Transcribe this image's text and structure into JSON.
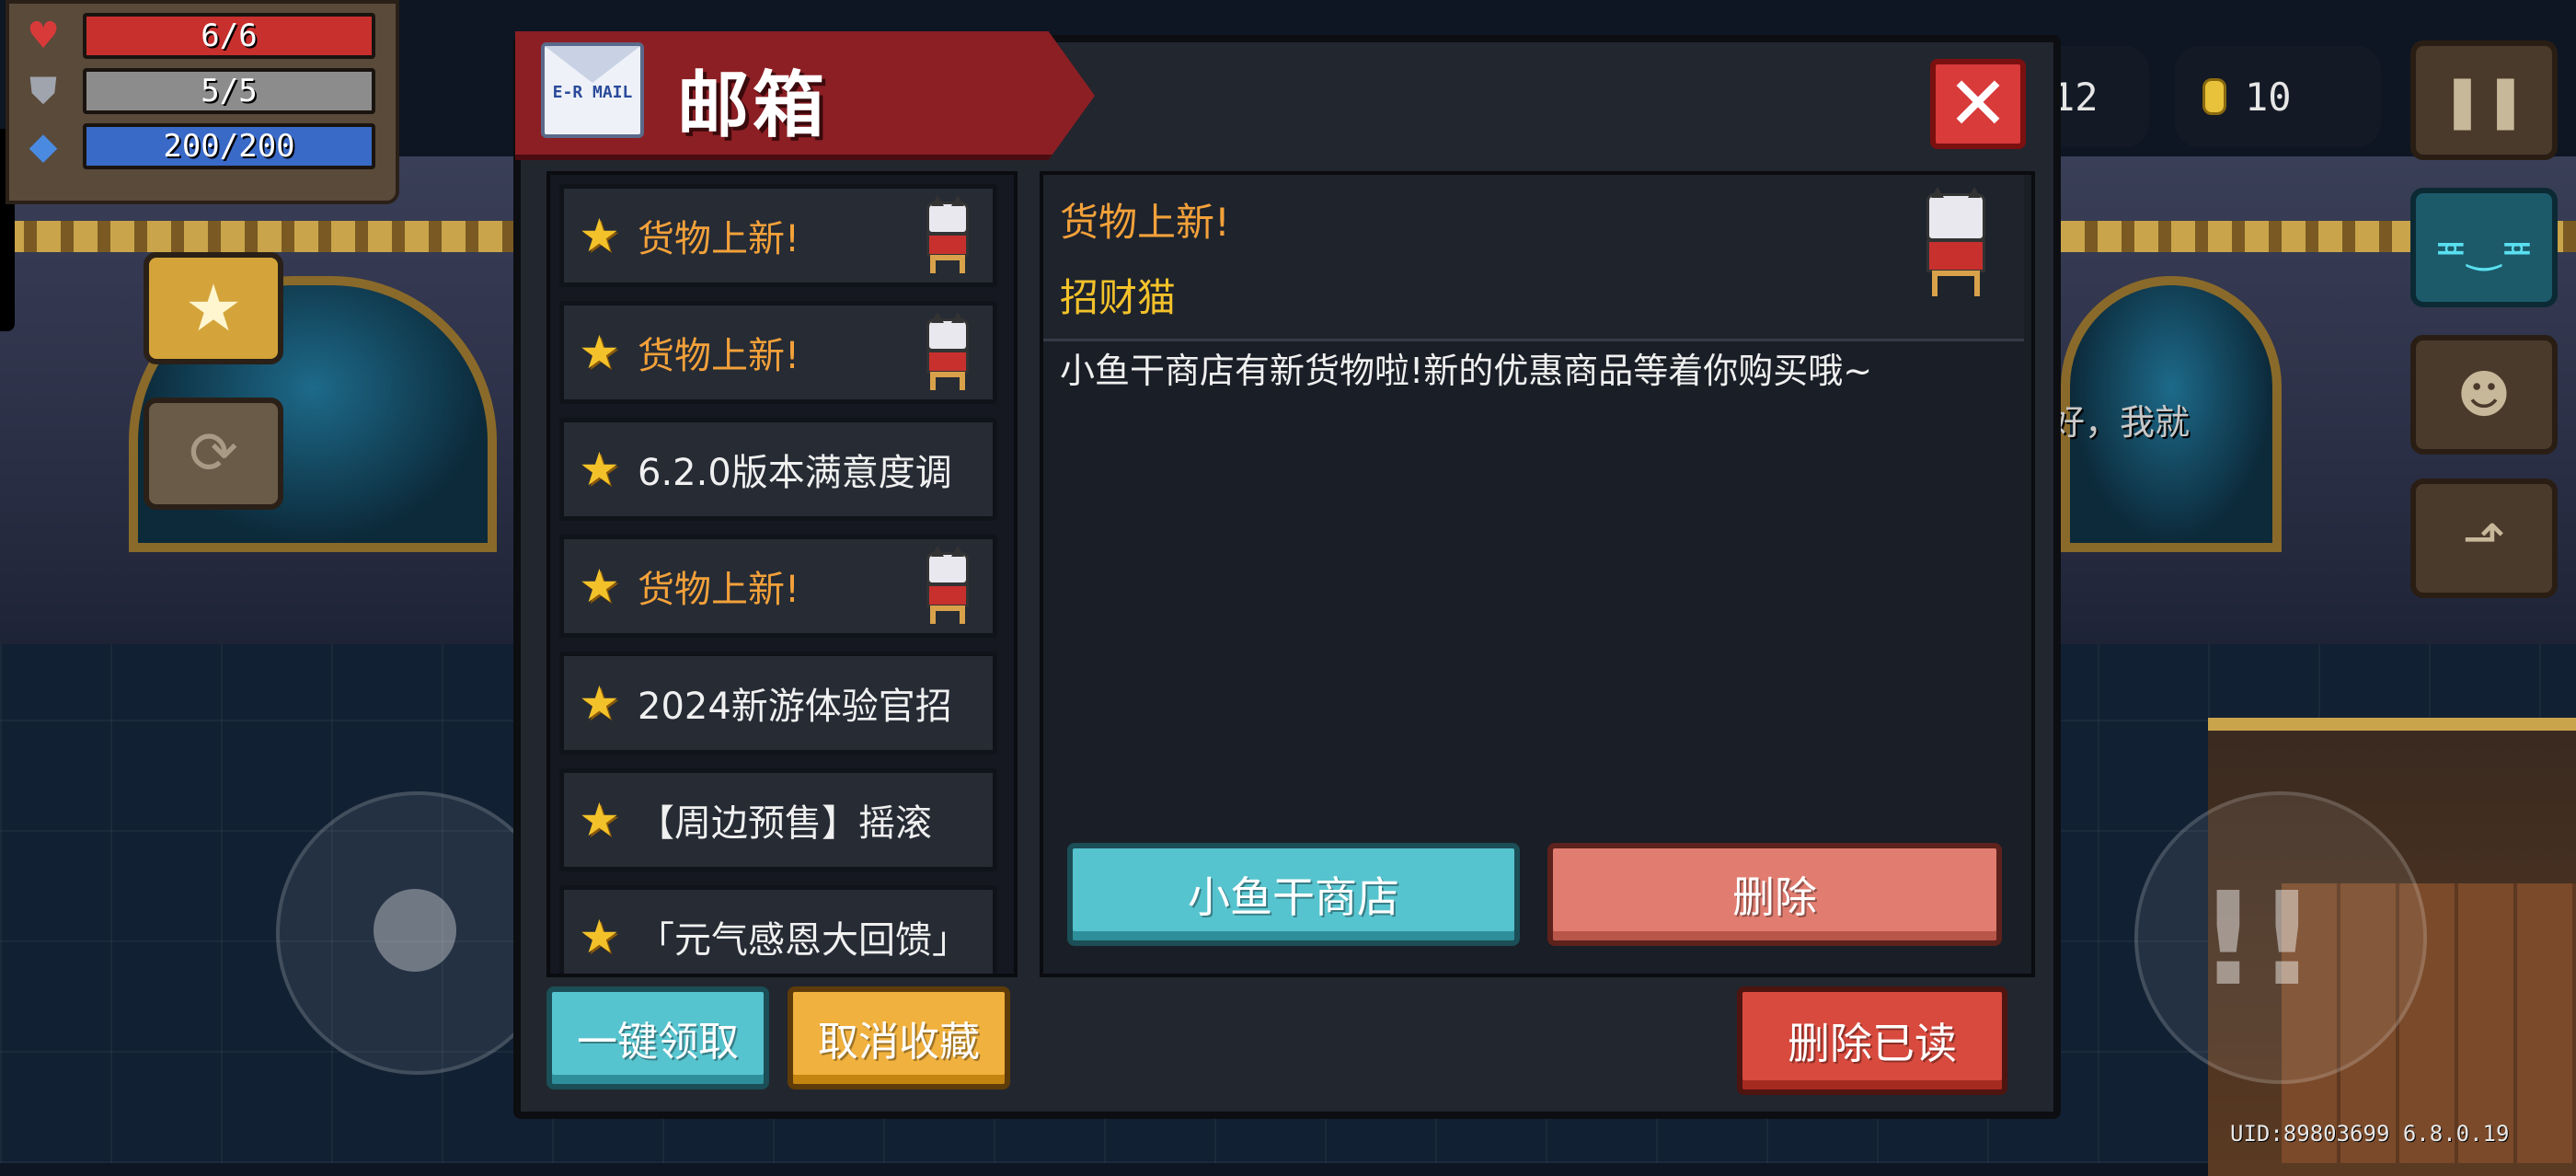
{
  "hud": {
    "hp": "6/6",
    "armor": "5/5",
    "energy": "200/200",
    "hp_fraction": 1.0,
    "armor_fraction": 1.0,
    "energy_fraction": 1.0,
    "gems": "12",
    "coins": "10"
  },
  "mailbox": {
    "title": "邮箱",
    "icon_label": "E-R MAIL",
    "mails": [
      {
        "title": "货物上新!",
        "highlight": true,
        "has_cat": true
      },
      {
        "title": "货物上新!",
        "highlight": true,
        "has_cat": true
      },
      {
        "title": "6.2.0版本满意度调",
        "highlight": false,
        "has_cat": false
      },
      {
        "title": "货物上新!",
        "highlight": true,
        "has_cat": true
      },
      {
        "title": "2024新游体验官招",
        "highlight": false,
        "has_cat": false
      },
      {
        "title": "【周边预售】摇滚",
        "highlight": false,
        "has_cat": false
      },
      {
        "title": "「元气感恩大回馈」",
        "highlight": false,
        "has_cat": false
      }
    ],
    "detail": {
      "title": "货物上新!",
      "sender": "招财猫",
      "body": "小鱼干商店有新货物啦!新的优惠商品等着你购买哦~"
    },
    "buttons": {
      "shop": "小鱼干商店",
      "delete": "删除",
      "claim_all": "一键领取",
      "unfavorite": "取消收藏",
      "delete_read": "删除已读"
    }
  },
  "background_text": "好，我就",
  "uid_version": "UID:89803699 6.8.0.19",
  "colors": {
    "banner_red": "#8c1f24",
    "close_red": "#d93a3a",
    "teal_button": "#56c4cf",
    "salmon_button": "#e17d70",
    "gold_button": "#f0b13e",
    "star_gold": "#f3c22a",
    "highlight_orange": "#f3a13a"
  },
  "icons": [
    "heart-icon",
    "shield-icon",
    "energy-diamond-icon",
    "gem-icon",
    "coin-icon",
    "pause-icon",
    "chat-icon",
    "profile-icon",
    "exit-icon",
    "close-icon",
    "star-icon",
    "lucky-cat-icon",
    "mail-envelope-icon"
  ]
}
